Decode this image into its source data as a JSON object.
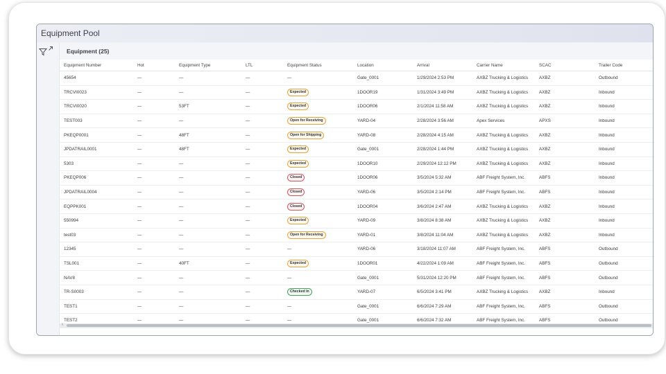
{
  "window": {
    "title": "Equipment Pool"
  },
  "panel": {
    "header": "Equipment (25)"
  },
  "icons": {
    "filter": "filter-icon",
    "expand": "expand-icon"
  },
  "columns": [
    "Equipment Number",
    "Hot",
    "Equipment Type",
    "LTL",
    "Equipment Status",
    "Location",
    "Arrival",
    "Carrier Name",
    "SCAC",
    "Trailer Code"
  ],
  "rows": [
    {
      "number": "45654",
      "hot": "—",
      "type": "—",
      "ltl": "—",
      "status": "—",
      "location": "Gate_0001",
      "arrival": "1/29/2024 2:53 PM",
      "carrier": "AXBZ Trucking & Logistics",
      "scac": "AXBZ",
      "trailer": "Outbound"
    },
    {
      "number": "TRCVI0023",
      "hot": "—",
      "type": "—",
      "ltl": "—",
      "status": "Expected",
      "location": "1DOOR19",
      "arrival": "1/31/2024 3:49 PM",
      "carrier": "AXBZ Trucking & Logistics",
      "scac": "AXBZ",
      "trailer": "Inbound"
    },
    {
      "number": "TRCVI0020",
      "hot": "—",
      "type": "53FT",
      "ltl": "—",
      "status": "Expected",
      "location": "1DOOR06",
      "arrival": "2/1/2024 11:58 AM",
      "carrier": "AXBZ Trucking & Logistics",
      "scac": "AXBZ",
      "trailer": "Inbound"
    },
    {
      "number": "TEST003",
      "hot": "—",
      "type": "—",
      "ltl": "—",
      "status": "Open for Receiving",
      "location": "YARD-04",
      "arrival": "2/28/2024 3:56 AM",
      "carrier": "Apex Services",
      "scac": "APXS",
      "trailer": "Inbound"
    },
    {
      "number": "PKEQP0001",
      "hot": "—",
      "type": "48FT",
      "ltl": "—",
      "status": "Open for Shipping",
      "location": "YARD-08",
      "arrival": "2/28/2024 4:15 AM",
      "carrier": "AXBZ Trucking & Logistics",
      "scac": "AXBZ",
      "trailer": "Inbound"
    },
    {
      "number": "JPDATRAIL0001",
      "hot": "—",
      "type": "48FT",
      "ltl": "—",
      "status": "Expected",
      "location": "Gate_0001",
      "arrival": "2/28/2024 1:44 PM",
      "carrier": "AXBZ Trucking & Logistics",
      "scac": "AXBZ",
      "trailer": "Inbound"
    },
    {
      "number": "5303",
      "hot": "—",
      "type": "—",
      "ltl": "—",
      "status": "Expected",
      "location": "1DOOR10",
      "arrival": "2/29/2024 12:12 PM",
      "carrier": "AXBZ Trucking & Logistics",
      "scac": "AXBZ",
      "trailer": "Inbound"
    },
    {
      "number": "PKEQP006",
      "hot": "—",
      "type": "—",
      "ltl": "—",
      "status": "Closed",
      "location": "1DOOR06",
      "arrival": "3/5/2024 5:32 AM",
      "carrier": "ABF Freight System, Inc.",
      "scac": "ABFS",
      "trailer": "Inbound"
    },
    {
      "number": "JPDATRAIL0004",
      "hot": "—",
      "type": "—",
      "ltl": "—",
      "status": "Closed",
      "location": "YARD-06",
      "arrival": "3/5/2024 2:14 PM",
      "carrier": "ABF Freight System, Inc.",
      "scac": "ABFS",
      "trailer": "Inbound"
    },
    {
      "number": "EQPPK001",
      "hot": "—",
      "type": "—",
      "ltl": "—",
      "status": "Closed",
      "location": "1DOOR04",
      "arrival": "3/6/2024 2:47 AM",
      "carrier": "AXBZ Trucking & Logistics",
      "scac": "AXBZ",
      "trailer": "Inbound"
    },
    {
      "number": "550994",
      "hot": "—",
      "type": "—",
      "ltl": "—",
      "status": "Expected",
      "location": "YARD-09",
      "arrival": "3/8/2024 8:38 AM",
      "carrier": "AXBZ Trucking & Logistics",
      "scac": "AXBZ",
      "trailer": "Inbound"
    },
    {
      "number": "test03",
      "hot": "—",
      "type": "—",
      "ltl": "—",
      "status": "Open for Receiving",
      "location": "YARD-01",
      "arrival": "3/8/2024 11:04 AM",
      "carrier": "AXBZ Trucking & Logistics",
      "scac": "AXBZ",
      "trailer": "Inbound"
    },
    {
      "number": "12345",
      "hot": "—",
      "type": "—",
      "ltl": "—",
      "status": "—",
      "location": "YARD-06",
      "arrival": "3/18/2024 11:07 AM",
      "carrier": "ABF Freight System, Inc.",
      "scac": "ABFS",
      "trailer": "Outbound"
    },
    {
      "number": "TSL001",
      "hot": "—",
      "type": "40FT",
      "ltl": "—",
      "status": "Expected",
      "location": "1DOOR01",
      "arrival": "4/22/2024 1:09 AM",
      "carrier": "ABF Freight System, Inc.",
      "scac": "ABFS",
      "trailer": "Outbound"
    },
    {
      "number": "NAV8",
      "hot": "—",
      "type": "—",
      "ltl": "—",
      "status": "—",
      "location": "Gate_0001",
      "arrival": "5/31/2024 12:20 PM",
      "carrier": "ABF Freight System, Inc.",
      "scac": "ABFS",
      "trailer": "Outbound"
    },
    {
      "number": "TR-S0003",
      "hot": "—",
      "type": "—",
      "ltl": "—",
      "status": "Checked In",
      "location": "YARD-07",
      "arrival": "6/5/2024 3:41 PM",
      "carrier": "AXBZ Trucking & Logistics",
      "scac": "AXBZ",
      "trailer": "Inbound"
    },
    {
      "number": "TEST1",
      "hot": "—",
      "type": "—",
      "ltl": "—",
      "status": "—",
      "location": "Gate_0001",
      "arrival": "6/6/2024 7:29 AM",
      "carrier": "ABF Freight System, Inc.",
      "scac": "ABFS",
      "trailer": "Outbound"
    },
    {
      "number": "TEST2",
      "hot": "—",
      "type": "—",
      "ltl": "—",
      "status": "—",
      "location": "Gate_0001",
      "arrival": "6/6/2024 7:32 AM",
      "carrier": "ABF Freight System, Inc.",
      "scac": "ABFS",
      "trailer": "Outbound"
    }
  ]
}
